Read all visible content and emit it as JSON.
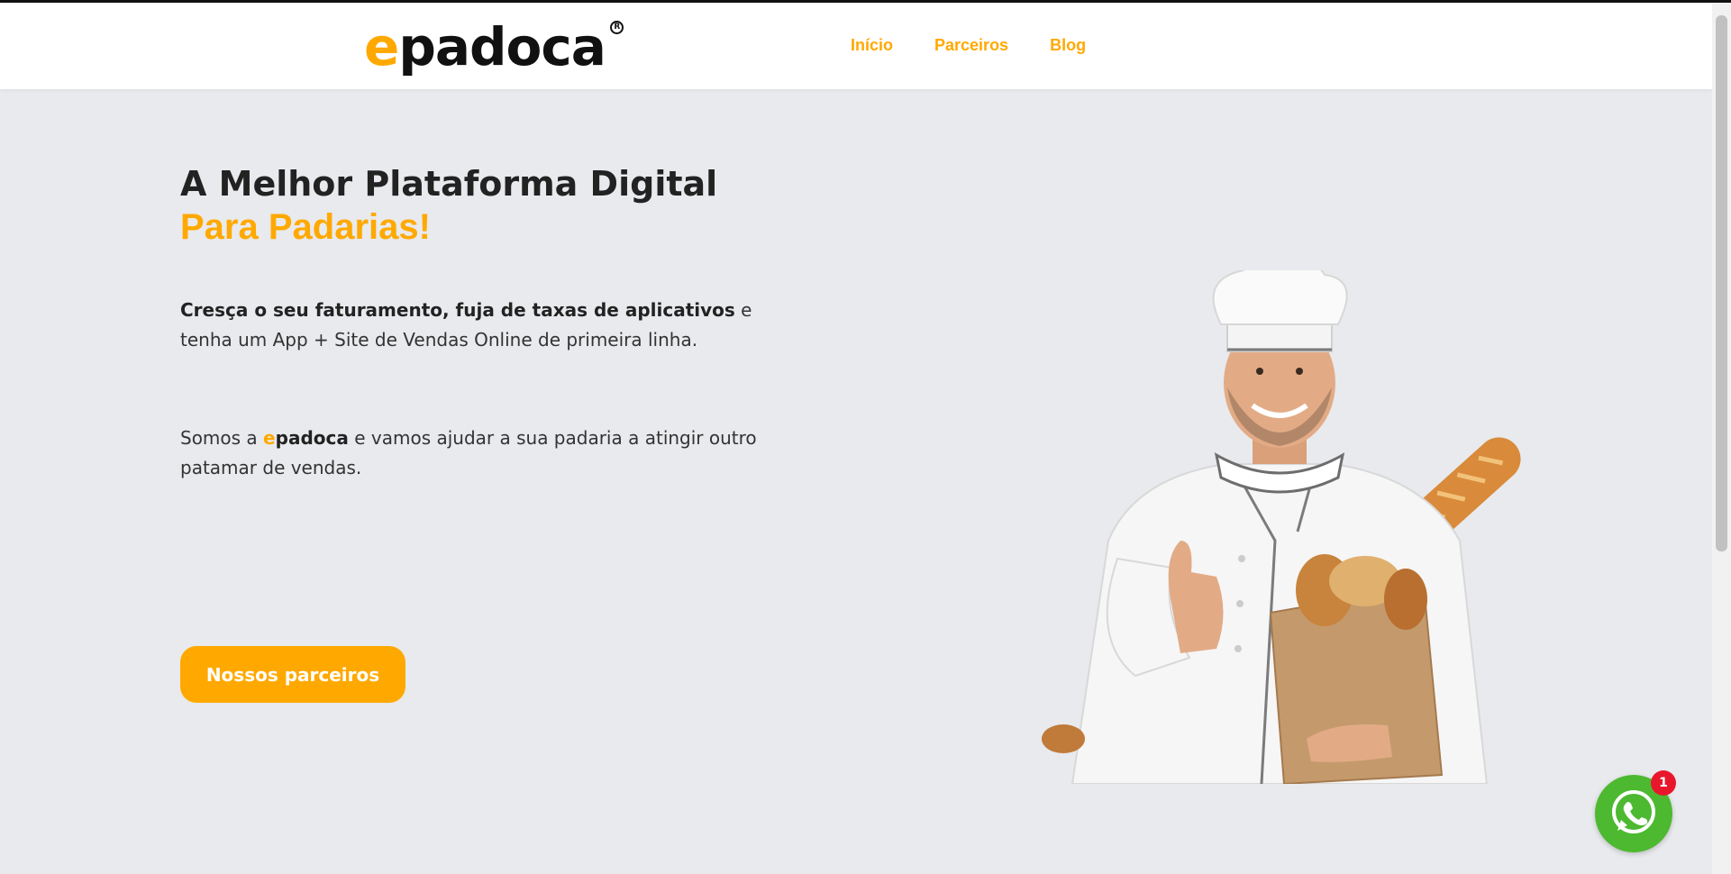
{
  "header": {
    "logo_accent": "e",
    "logo_rest": "padoca",
    "logo_reg": "R",
    "nav": [
      {
        "label": "Início"
      },
      {
        "label": "Parceiros"
      },
      {
        "label": "Blog"
      }
    ]
  },
  "hero": {
    "title_line1": "A Melhor Plataforma Digital",
    "title_line2": "Para Padarias!",
    "p1_bold": "Cresça o seu faturamento, fuja de taxas de aplicativos",
    "p1_rest": " e tenha um App + Site de Vendas Online de primeira linha.",
    "p2_before": "Somos a ",
    "p2_brand_accent": "e",
    "p2_brand_rest": "padoca",
    "p2_after": " e vamos ajudar a sua padaria a atingir outro patamar de vendas.",
    "cta_label": "Nossos parceiros"
  },
  "whatsapp": {
    "badge_count": "1"
  },
  "colors": {
    "accent": "#ffa900",
    "background": "#e8eaed",
    "whatsapp_green": "#4cb930",
    "badge_red": "#e8172c"
  },
  "icons": {
    "hero_image": "chef-with-bread-illustration",
    "whatsapp": "whatsapp-icon"
  }
}
